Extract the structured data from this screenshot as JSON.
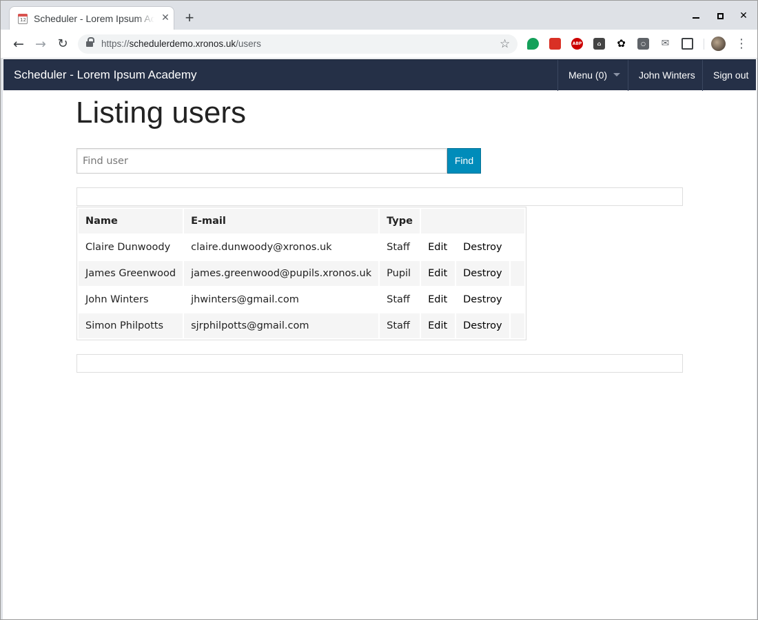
{
  "browser": {
    "tab_title": "Scheduler - Lorem Ipsum Academy",
    "tab_favicon_text": "12",
    "url_scheme": "https://",
    "url_host": "schedulerdemo.xronos.uk",
    "url_path": "/users",
    "icons": [
      "calendar-favicon",
      "close-icon",
      "plus-icon",
      "minimize-icon",
      "maximize-icon",
      "window-close-icon",
      "back-arrow-icon",
      "forward-arrow-icon",
      "reload-icon",
      "lock-icon",
      "star-icon",
      "evernote-icon",
      "pdf-icon",
      "adblock-icon",
      "house-icon",
      "paw-icon",
      "bulb-icon",
      "mail-icon",
      "screenshot-icon",
      "avatar",
      "kebab-menu-icon"
    ]
  },
  "appbar": {
    "brand": "Scheduler - Lorem Ipsum Academy",
    "menu_label": "Menu (0)",
    "user_label": "John Winters",
    "signout_label": "Sign out",
    "background": "#253047"
  },
  "main": {
    "heading": "Listing users",
    "search_placeholder": "Find user",
    "search_button": "Find",
    "accent": "#008cba"
  },
  "table": {
    "headers": [
      "Name",
      "E-mail",
      "Type",
      ""
    ],
    "rows": [
      {
        "name": "Claire Dunwoody",
        "email": "claire.dunwoody@xronos.uk",
        "type": "Staff",
        "edit": "Edit",
        "destroy": "Destroy"
      },
      {
        "name": "James Greenwood",
        "email": "james.greenwood@pupils.xronos.uk",
        "type": "Pupil",
        "edit": "Edit",
        "destroy": "Destroy"
      },
      {
        "name": "John Winters",
        "email": "jhwinters@gmail.com",
        "type": "Staff",
        "edit": "Edit",
        "destroy": "Destroy"
      },
      {
        "name": "Simon Philpotts",
        "email": "sjrphilpotts@gmail.com",
        "type": "Staff",
        "edit": "Edit",
        "destroy": "Destroy"
      }
    ]
  }
}
